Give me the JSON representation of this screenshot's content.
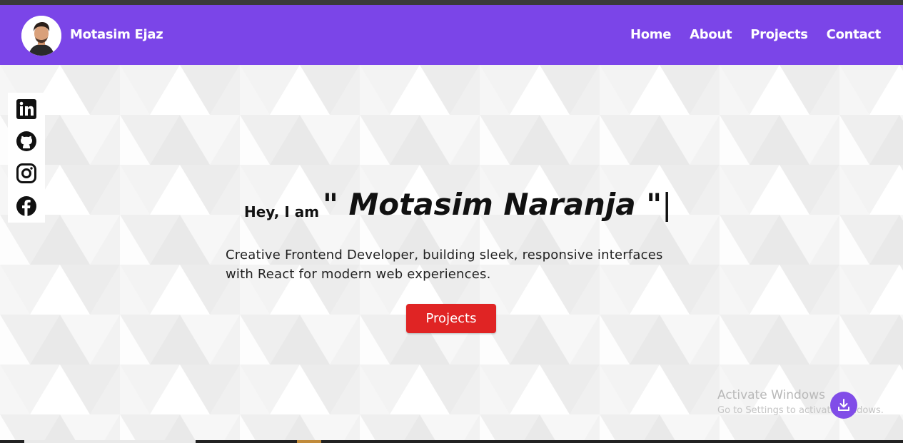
{
  "header": {
    "brand_name": "Motasim Ejaz",
    "nav": [
      {
        "label": "Home"
      },
      {
        "label": "About"
      },
      {
        "label": "Projects"
      },
      {
        "label": "Contact"
      }
    ]
  },
  "social": [
    "linkedin-icon",
    "github-icon",
    "instagram-icon",
    "facebook-icon"
  ],
  "hero": {
    "greeting": "Hey, I am",
    "name_open_quote": "\"",
    "name": "Motasim Naranja",
    "name_close_quote": "\"",
    "cursor": "|",
    "description": "Creative Frontend Developer, building sleek, responsive interfaces with React for modern web experiences.",
    "button_label": "Projects"
  },
  "watermark": {
    "line1": "Activate Windows",
    "line2": "Go to Settings to activate Windows."
  },
  "colors": {
    "accent": "#7b45e8",
    "button": "#e02424"
  }
}
